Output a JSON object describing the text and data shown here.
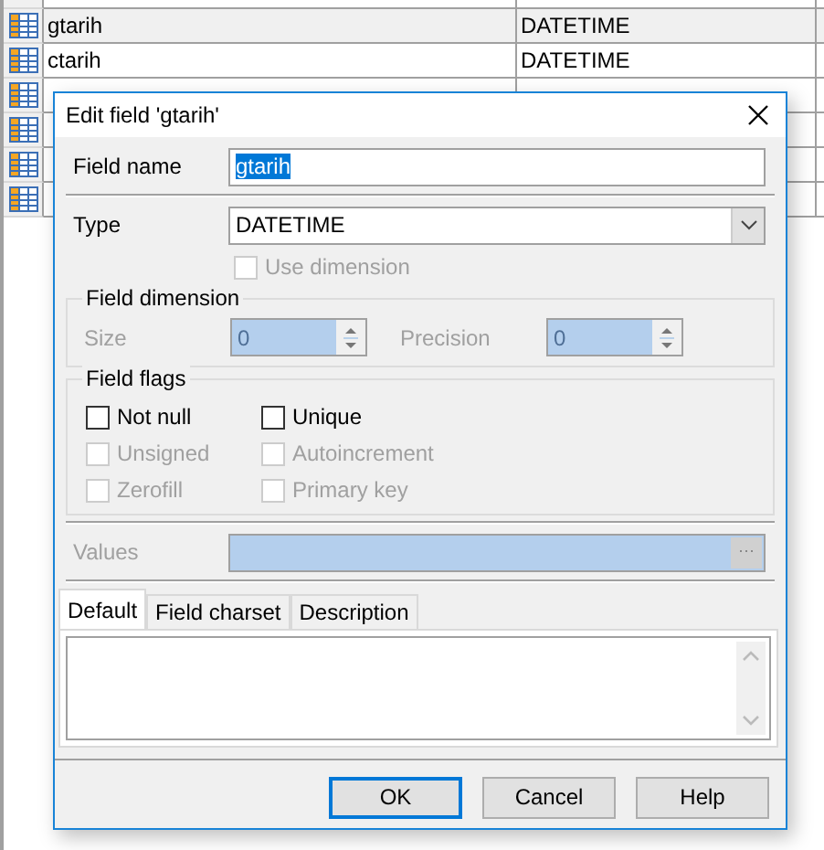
{
  "table": {
    "rows": [
      {
        "name": "gtarih",
        "type": "DATETIME"
      },
      {
        "name": "ctarih",
        "type": "DATETIME"
      },
      {},
      {},
      {},
      {}
    ]
  },
  "dialog": {
    "title": "Edit field 'gtarih'",
    "field_name": {
      "label": "Field name",
      "value": "gtarih",
      "selected": true
    },
    "type": {
      "label": "Type",
      "value": "DATETIME"
    },
    "use_dimension": {
      "label": "Use dimension",
      "checked": false,
      "disabled": true
    },
    "field_dimension": {
      "title": "Field dimension",
      "size": {
        "label": "Size",
        "value": "0",
        "disabled": true
      },
      "precision": {
        "label": "Precision",
        "value": "0",
        "disabled": true
      }
    },
    "field_flags": {
      "title": "Field flags",
      "flags": [
        {
          "label": "Not null",
          "checked": false,
          "disabled": false
        },
        {
          "label": "Unique",
          "checked": false,
          "disabled": false
        },
        {
          "label": "Unsigned",
          "checked": false,
          "disabled": true
        },
        {
          "label": "Autoincrement",
          "checked": false,
          "disabled": true
        },
        {
          "label": "Zerofill",
          "checked": false,
          "disabled": true
        },
        {
          "label": "Primary key",
          "checked": false,
          "disabled": true
        }
      ]
    },
    "values": {
      "label": "Values",
      "disabled": true
    },
    "tabs": [
      {
        "label": "Default",
        "selected": true
      },
      {
        "label": "Field charset",
        "selected": false
      },
      {
        "label": "Description",
        "selected": false
      }
    ],
    "buttons": [
      {
        "label": "OK",
        "focused": true
      },
      {
        "label": "Cancel",
        "focused": false
      },
      {
        "label": "Help",
        "focused": false
      }
    ]
  }
}
